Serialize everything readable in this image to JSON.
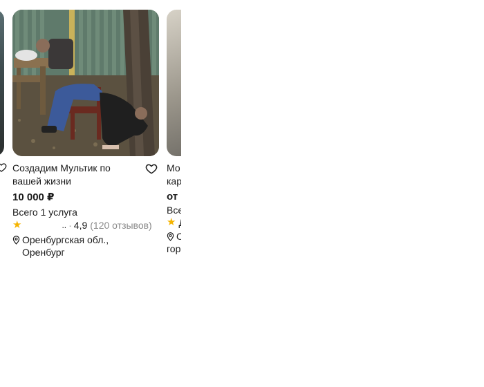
{
  "colors": {
    "accent_star": "#f5b400",
    "muted": "#8a8a8a",
    "text": "#1a1a1a"
  },
  "cards": [
    {
      "title_line1": "Создадим Мультик по",
      "title_line2": "вашей жизни",
      "price": "10 000 ₽",
      "services": "Всего 1 услуга",
      "rating_ellipsis": "..",
      "rating_sep": "·",
      "rating": "4,9",
      "reviews": "(120 отзывов)",
      "location_line1": "Оренбургская обл.,",
      "location_line2": "Оренбург",
      "favorite_icon": "heart-outline-icon",
      "location_icon": "map-pin-icon"
    }
  ],
  "right_card": {
    "title_line1": "Мо",
    "title_line2": "кар",
    "price": "от",
    "services": "Все",
    "rating": "Д",
    "location_line1": "О",
    "location_line2": "гор"
  }
}
